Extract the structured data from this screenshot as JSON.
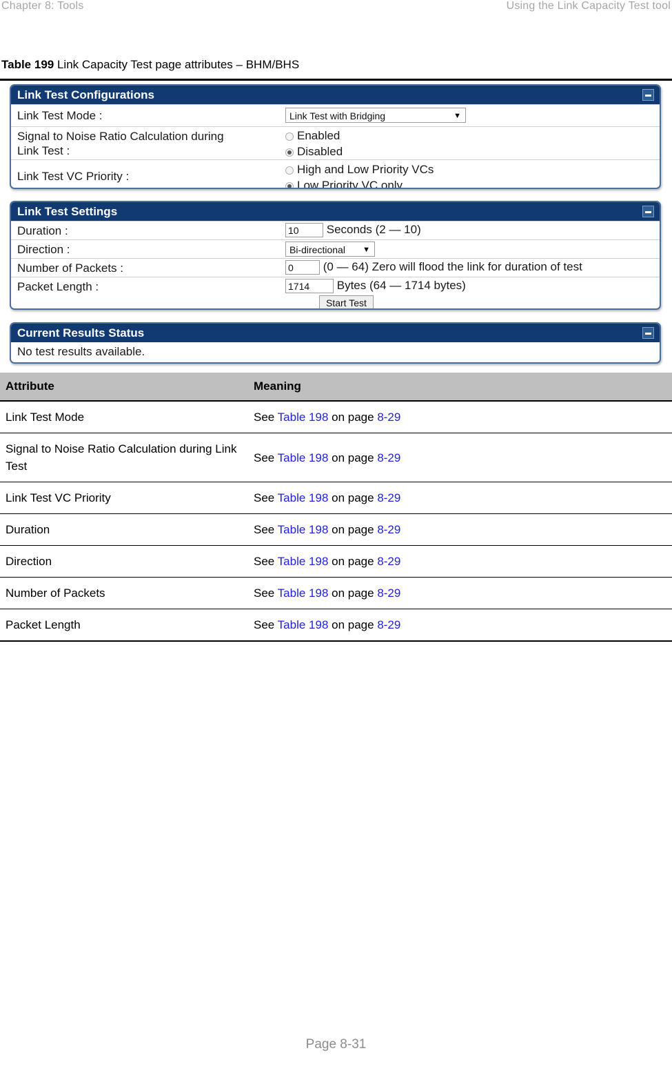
{
  "running_head": {
    "left": "Chapter 8:  Tools",
    "right": "Using the Link Capacity Test tool"
  },
  "caption": {
    "number": "Table 199",
    "text": "Link Capacity Test page attributes – BHM/BHS"
  },
  "gui": {
    "configurations_panel": {
      "title": "Link Test Configurations",
      "rows": {
        "mode_label": "Link Test Mode :",
        "mode_value": "Link Test with Bridging",
        "snr_label_line1": "Signal to Noise Ratio Calculation during",
        "snr_label_line2": "Link Test :",
        "snr_option_enabled": "Enabled",
        "snr_option_disabled": "Disabled",
        "vc_label": "Link Test VC Priority :",
        "vc_option_high_low": "High and Low Priority VCs",
        "vc_option_low_only": "Low Priority VC only"
      }
    },
    "settings_panel": {
      "title": "Link Test Settings",
      "rows": {
        "duration_label": "Duration :",
        "duration_value": "10",
        "duration_hint": "Seconds (2 — 10)",
        "direction_label": "Direction :",
        "direction_value": "Bi-directional",
        "packets_label": "Number of Packets :",
        "packets_value": "0",
        "packets_hint": "(0 — 64) Zero will flood the link for duration of test",
        "length_label": "Packet Length :",
        "length_value": "1714",
        "length_hint": "Bytes (64 — 1714 bytes)",
        "start_button": "Start Test"
      }
    },
    "results_panel": {
      "title": "Current Results Status",
      "message": "No test results available."
    }
  },
  "attribute_table": {
    "headers": [
      "Attribute",
      "Meaning"
    ],
    "rows": [
      {
        "attribute": "Link Test Mode",
        "meaning_prefix": "See ",
        "meaning_table_ref": "Table 198",
        "meaning_mid": " on page ",
        "meaning_page_ref": "8-29"
      },
      {
        "attribute": "Signal to Noise Ratio Calculation during Link Test",
        "meaning_prefix": "See ",
        "meaning_table_ref": "Table 198",
        "meaning_mid": " on page ",
        "meaning_page_ref": "8-29"
      },
      {
        "attribute": "Link Test VC Priority",
        "meaning_prefix": "See ",
        "meaning_table_ref": "Table 198",
        "meaning_mid": " on page ",
        "meaning_page_ref": "8-29"
      },
      {
        "attribute": "Duration",
        "meaning_prefix": "See ",
        "meaning_table_ref": "Table 198",
        "meaning_mid": " on page ",
        "meaning_page_ref": "8-29"
      },
      {
        "attribute": "Direction",
        "meaning_prefix": "See ",
        "meaning_table_ref": "Table 198",
        "meaning_mid": " on page ",
        "meaning_page_ref": "8-29"
      },
      {
        "attribute": "Number of Packets",
        "meaning_prefix": "See ",
        "meaning_table_ref": "Table 198",
        "meaning_mid": " on page ",
        "meaning_page_ref": "8-29"
      },
      {
        "attribute": "Packet Length",
        "meaning_prefix": "See ",
        "meaning_table_ref": "Table 198",
        "meaning_mid": " on page ",
        "meaning_page_ref": "8-29"
      }
    ]
  },
  "footer": {
    "page_number": "Page 8-31"
  },
  "colors": {
    "panel_header_blue": "#113a72",
    "panel_border": "#4a6f9e",
    "table_header_gray": "#bfbfbf",
    "cross_reference_blue": "#2222dd",
    "running_head_gray": "#a6a6a6"
  }
}
